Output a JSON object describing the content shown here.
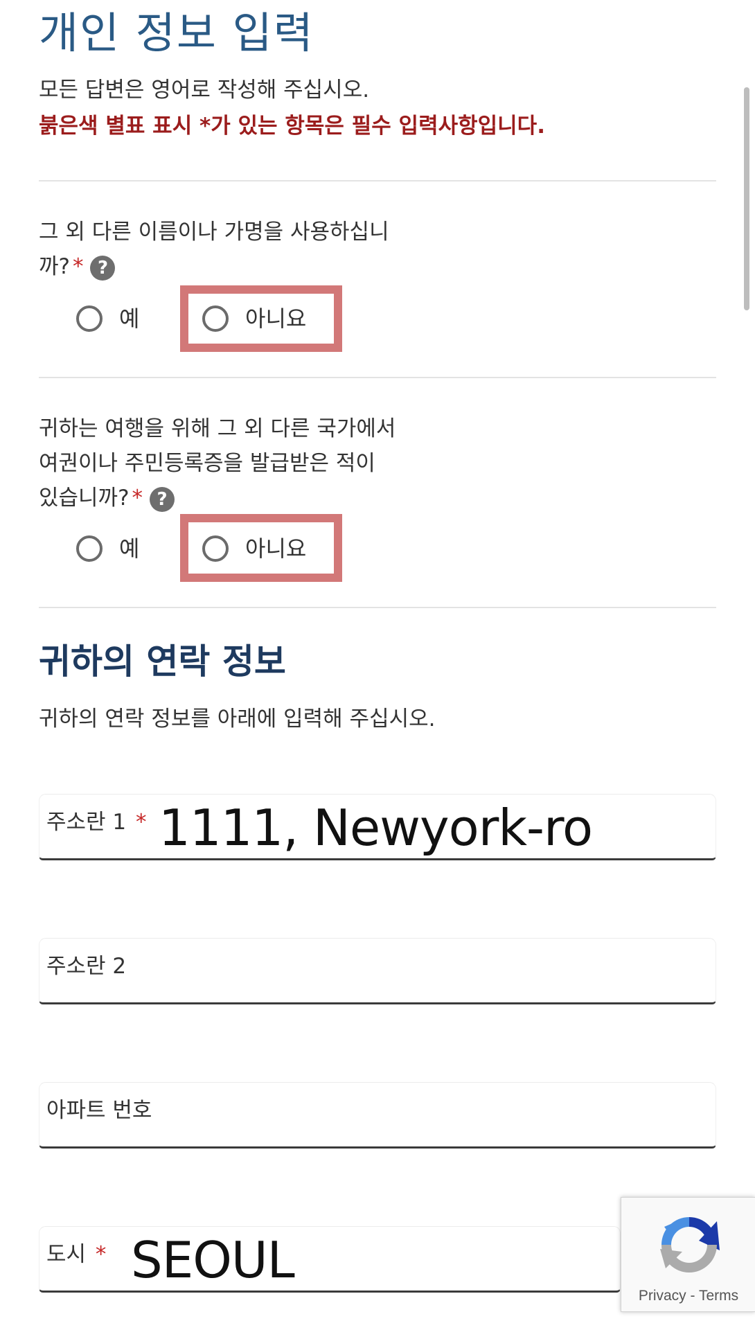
{
  "header": {
    "title": "개인 정보 입력",
    "intro": "모든 답변은 영어로 작성해 주십시오.",
    "required_note": "붉은색 별표 표시 *가 있는 항목은 필수 입력사항입니다."
  },
  "q_other_names": {
    "text_line1": "그 외 다른 이름이나 가명을 사용하십니",
    "text_line2": "까?",
    "required_mark": "*",
    "help_glyph": "?",
    "option_yes": "예",
    "option_no": "아니요"
  },
  "q_other_passport": {
    "text_line1": "귀하는 여행을 위해 그 외 다른 국가에서",
    "text_line2": "여권이나 주민등록증을 발급받은 적이",
    "text_line3": "있습니까?",
    "required_mark": "*",
    "help_glyph": "?",
    "option_yes": "예",
    "option_no": "아니요"
  },
  "contact": {
    "title": "귀하의 연락 정보",
    "subtitle": "귀하의 연락 정보를 아래에 입력해 주십시오.",
    "fields": [
      {
        "label": "주소란 1",
        "required_mark": "*",
        "value": "1111, Newyork-ro"
      },
      {
        "label": "주소란 2"
      },
      {
        "label": "아파트 번호"
      },
      {
        "label": "도시",
        "required_mark": "*",
        "value": "SEOUL"
      }
    ]
  },
  "recaptcha": {
    "privacy": "Privacy",
    "separator": " - ",
    "terms": "Terms"
  },
  "colors": {
    "title": "#2a5a85",
    "section_title": "#1e3a5f",
    "required_red": "#9b1c1c",
    "highlight": "#d27878"
  }
}
